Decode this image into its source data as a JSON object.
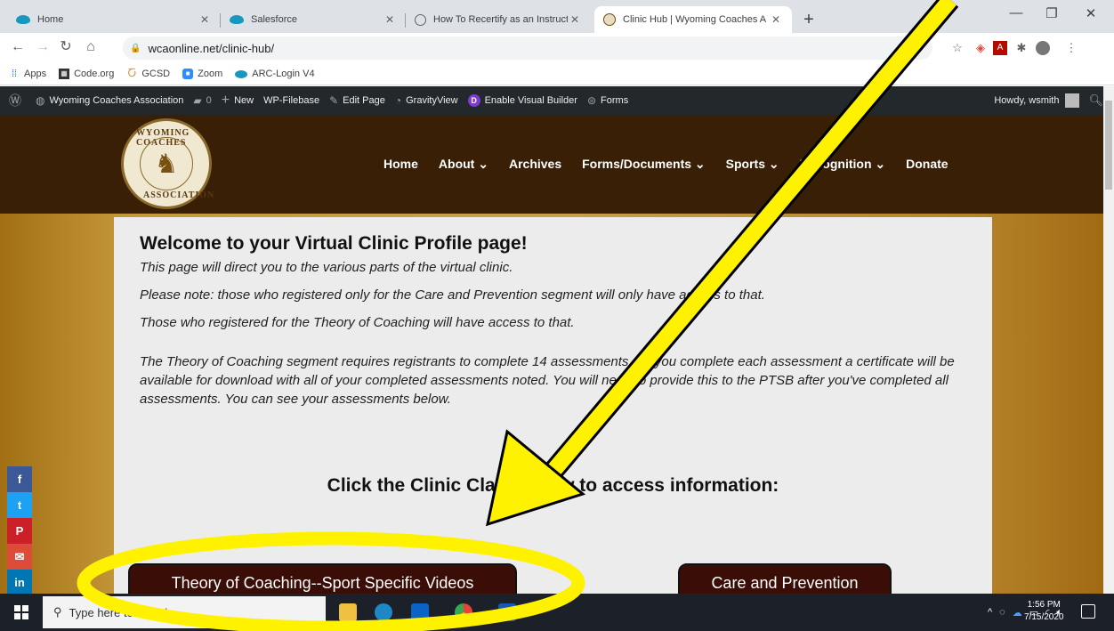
{
  "browser": {
    "tabs": [
      {
        "title": "Home",
        "favicon": "salesforce-cloud-icon"
      },
      {
        "title": "Salesforce",
        "favicon": "salesforce-cloud-icon"
      },
      {
        "title": "How To Recertify as an Instructor",
        "favicon": "globe-icon"
      },
      {
        "title": "Clinic Hub | Wyoming Coaches A",
        "favicon": "wca-logo-icon",
        "active": true
      }
    ],
    "url": "wcaonline.net/clinic-hub/",
    "bookmarks": [
      "Apps",
      "Code.org",
      "GCSD",
      "Zoom",
      "ARC-Login V4"
    ]
  },
  "wp_admin_bar": {
    "site_name": "Wyoming Coaches Association",
    "comments_count": "0",
    "items": [
      "New",
      "WP-Filebase",
      "Edit Page",
      "GravityView",
      "Enable Visual Builder",
      "Forms"
    ],
    "greeting": "Howdy, wsmith"
  },
  "site": {
    "logo_text_top": "WYOMING COACHES",
    "logo_text_bottom": "ASSOCIATION",
    "nav": [
      "Home",
      "About ⌄",
      "Archives",
      "Forms/Documents ⌄",
      "Sports ⌄",
      "Recognition ⌄",
      "Donate"
    ]
  },
  "page": {
    "heading": "Welcome to your Virtual Clinic Profile page!",
    "p1": "This page will direct you to the various parts of the virtual clinic.",
    "p2": "Please note: those who registered only for the Care and Prevention segment will only have access to that.",
    "p3": "Those who registered for the Theory of Coaching will have access to that.",
    "p4": "The Theory of Coaching segment requires registrants to complete 14 assessments. As you complete each assessment a certificate will be available for download with all of your completed assessments noted. You will need to provide this to the PTSB after you've completed all assessments. You can see your assessments below.",
    "click_heading": "Click the Clinic Class below to access information:",
    "buttons": [
      "Theory of Coaching--Sport Specific Videos",
      "Care and Prevention"
    ]
  },
  "social": [
    {
      "label": "f",
      "color": "#3b5998"
    },
    {
      "label": "t",
      "color": "#1da1f2"
    },
    {
      "label": "P",
      "color": "#cb2027"
    },
    {
      "label": "✉",
      "color": "#dd4b39"
    },
    {
      "label": "in",
      "color": "#0077b5"
    }
  ],
  "taskbar": {
    "search_placeholder": "Type here to search",
    "time": "1:56 PM",
    "date": "7/15/2020"
  },
  "annotation": {
    "color": "#fff200"
  }
}
